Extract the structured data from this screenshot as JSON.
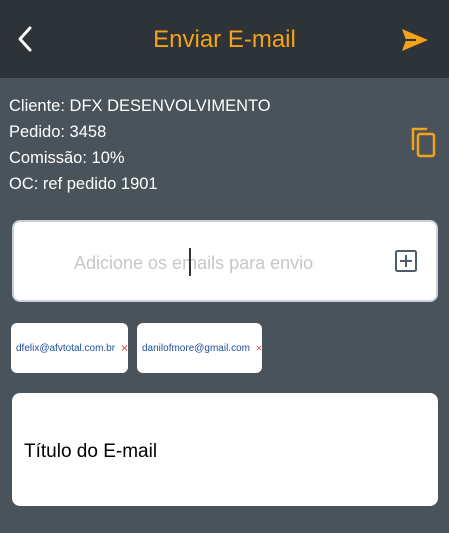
{
  "header": {
    "title": "Enviar E-mail"
  },
  "order_info": {
    "cliente": "Cliente: DFX DESENVOLVIMENTO",
    "pedido": "Pedido: 3458",
    "comissao": "Comissão: 10%",
    "oc": "OC: ref pedido 1901"
  },
  "email_input": {
    "placeholder": "Adicione os emails para envio"
  },
  "recipients": [
    {
      "email": "dfelix@afvtotal.com.br"
    },
    {
      "email": "danilofmore@gmail.com"
    }
  ],
  "subject": {
    "label": "Título do E-mail"
  },
  "colors": {
    "accent": "#f4a21a",
    "header_bg": "#2e3338",
    "page_bg": "#49535b",
    "remove_x": "#e53935"
  },
  "icons": [
    "back-chevron-icon",
    "send-icon",
    "copy-icon",
    "add-box-icon",
    "close-x-icon"
  ]
}
